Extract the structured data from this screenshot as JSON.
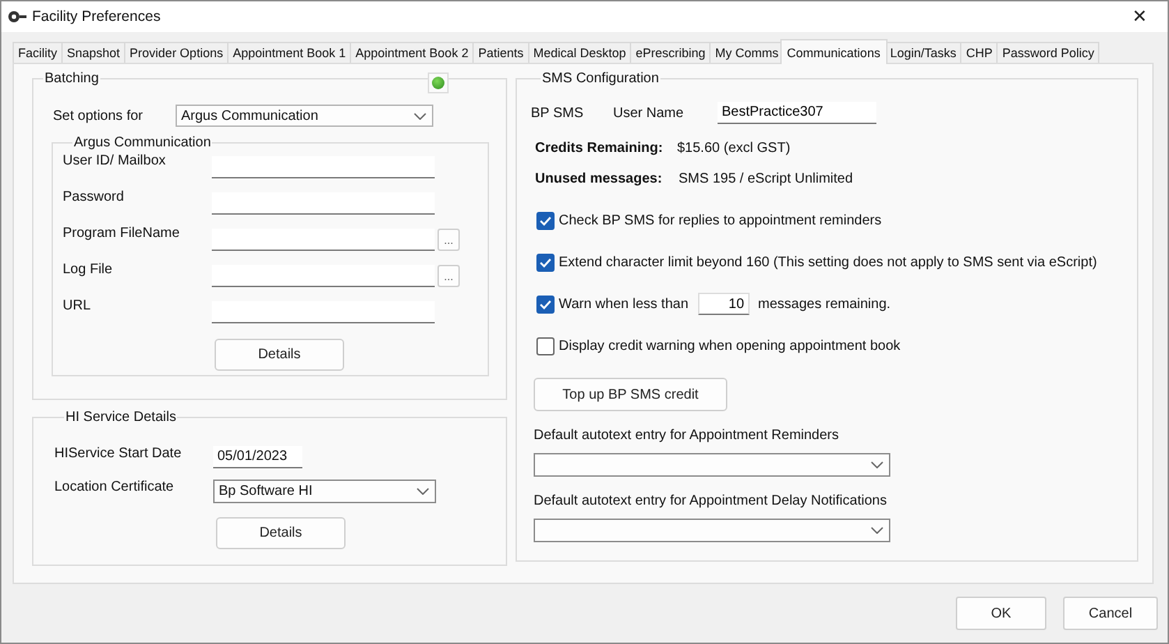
{
  "window": {
    "title": "Facility Preferences",
    "close": "✕"
  },
  "tabs": [
    {
      "label": "Facility",
      "selected": false
    },
    {
      "label": "Snapshot",
      "selected": false
    },
    {
      "label": "Provider Options",
      "selected": false
    },
    {
      "label": "Appointment Book 1",
      "selected": false
    },
    {
      "label": "Appointment Book 2",
      "selected": false
    },
    {
      "label": "Patients",
      "selected": false
    },
    {
      "label": "Medical Desktop",
      "selected": false
    },
    {
      "label": "ePrescribing",
      "selected": false
    },
    {
      "label": "My Comms",
      "selected": false
    },
    {
      "label": "Communications",
      "selected": true
    },
    {
      "label": "Login/Tasks",
      "selected": false
    },
    {
      "label": "CHP",
      "selected": false
    },
    {
      "label": "Password Policy",
      "selected": false
    }
  ],
  "batching": {
    "title": "Batching",
    "set_options_label": "Set options for",
    "set_options_value": "Argus Communication",
    "group": {
      "title": "Argus Communication",
      "fields": [
        {
          "label": "User ID/ Mailbox"
        },
        {
          "label": "Password"
        },
        {
          "label": "Program FileName",
          "browse_button": "..."
        },
        {
          "label": "Log File",
          "browse_button": "..."
        },
        {
          "label": "URL"
        }
      ]
    },
    "button": "Details"
  },
  "hi_service": {
    "title": "HI Service Details",
    "fields": [
      {
        "kind": "date",
        "label": "HIService Start Date",
        "value": "05/01/2023"
      },
      {
        "kind": "dropdown",
        "label": "Location Certificate",
        "value": "Bp Software HI"
      }
    ],
    "button": "Details"
  },
  "sms": {
    "title": "SMS Configuration",
    "service": "BP SMS",
    "user_label": "User Name",
    "user_value": "BestPractice307",
    "info": [
      {
        "label": "Credits Remaining:",
        "value": "$15.60 (excl GST)"
      },
      {
        "label": "Unused messages:",
        "value": "SMS 195 / eScript Unlimited"
      }
    ],
    "options": [
      {
        "kind": "checkbox",
        "label": "Check BP SMS for replies to appointment reminders",
        "checked": true
      },
      {
        "kind": "checkbox",
        "label": "Extend character limit beyond 160 (This setting does not apply to SMS sent via eScript)",
        "checked": true
      },
      {
        "kind": "threshold",
        "label": "Warn when less than",
        "value": "10",
        "suffix": "messages remaining.",
        "checked": true
      },
      {
        "kind": "checkbox",
        "label": "Display credit warning when opening appointment book",
        "checked": false
      }
    ],
    "topup_button": "Top up BP SMS credit",
    "dropdowns": [
      {
        "label": "Default autotext entry for Appointment Reminders"
      },
      {
        "label": "Default autotext entry for Appointment Delay Notifications"
      }
    ]
  },
  "buttons": [
    {
      "label": "OK"
    },
    {
      "label": "Cancel"
    }
  ]
}
